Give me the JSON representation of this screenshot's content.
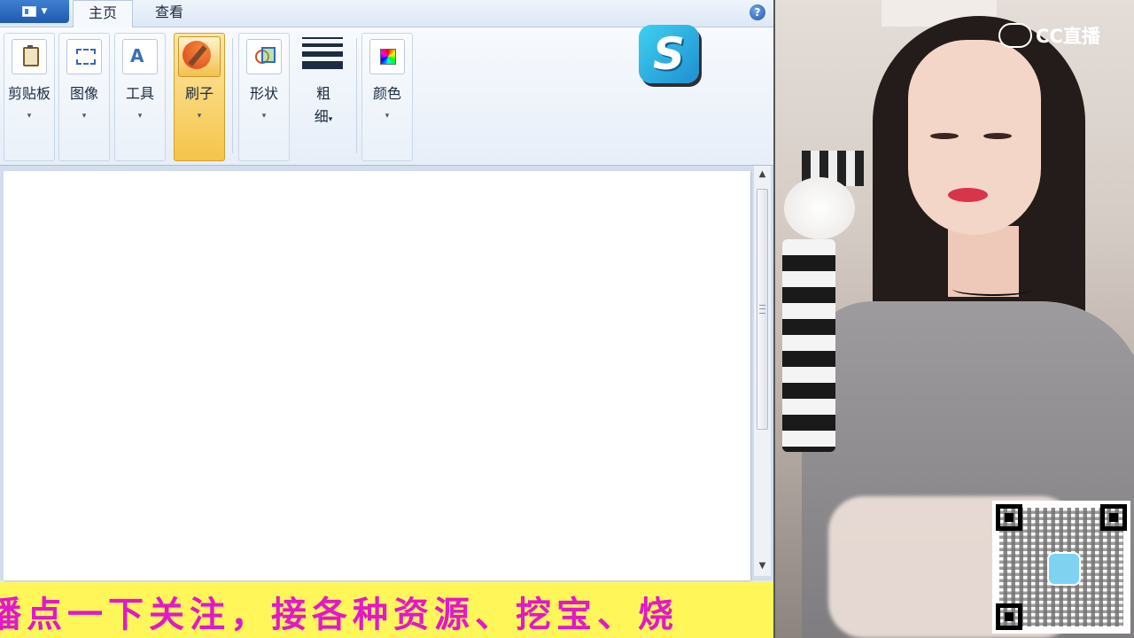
{
  "paint": {
    "tabs": {
      "home": "主页",
      "view": "查看"
    },
    "help": "?",
    "groups": {
      "clipboard": "剪贴板",
      "image": "图像",
      "tools": "工具",
      "brushes": "刷子",
      "shapes": "形状",
      "size_line1": "粗",
      "size_line2": "细",
      "colors": "颜色"
    },
    "caret": "▾",
    "scroll_up": "▲",
    "scroll_down": "▼"
  },
  "logo": {
    "letter": "S"
  },
  "banner": {
    "text": "播点一下关注，接各种资源、挖宝、烧"
  },
  "overlay": {
    "cc_text": "CC直播"
  },
  "colors": {
    "banner_bg": "#fff65a",
    "banner_text": "#e218c9",
    "active_group": "#f5c54a"
  }
}
